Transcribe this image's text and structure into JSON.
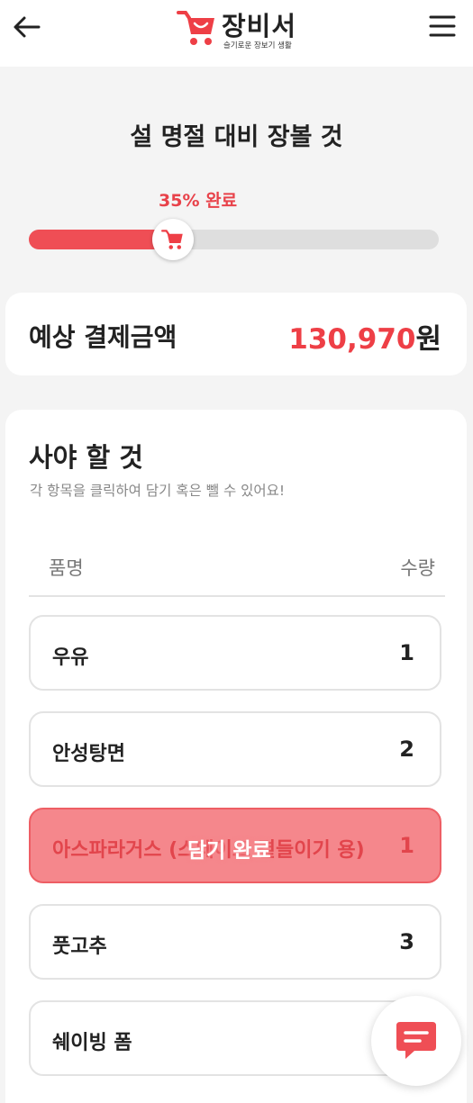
{
  "app": {
    "title": "장비서",
    "subtitle": "슬기로운 장보기 생활"
  },
  "list": {
    "title": "설 명절 대비 장볼 것",
    "progress_label": "35% 완료",
    "progress_fraction": 0.35
  },
  "payment": {
    "label": "예상 결제금액",
    "amount": "130,970",
    "currency": "원"
  },
  "todo": {
    "title": "사야 할 것",
    "hint": "각 항목을 클릭하여 담기 혹은 뺄 수 있어요!",
    "columns": {
      "name": "품명",
      "qty": "수량"
    },
    "items": [
      {
        "name": "우유",
        "qty": "1"
      },
      {
        "name": "안성탕면",
        "qty": "2"
      },
      {
        "name": "아스파라거스 (스테이크 곁들이기 용)",
        "qty": "1",
        "status": "담기 완료"
      },
      {
        "name": "풋고추",
        "qty": "3"
      },
      {
        "name": "쉐이빙 폼",
        "qty": ""
      }
    ]
  },
  "colors": {
    "accent": "#ef4e55",
    "done_bg": "#f5878c"
  },
  "icons": {
    "back": "arrow-left-icon",
    "menu": "hamburger-menu-icon",
    "logo": "shopping-cart-icon",
    "knob": "shopping-cart-icon",
    "chat": "chat-bubble-icon"
  }
}
